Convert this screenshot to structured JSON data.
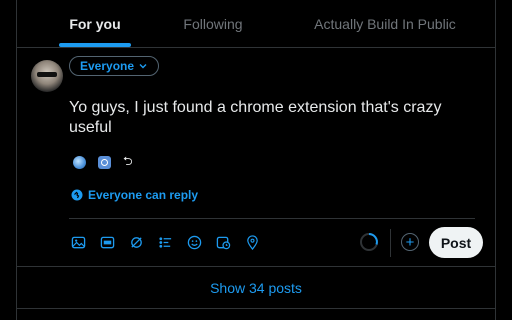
{
  "tabs": [
    {
      "label": "For you",
      "active": true
    },
    {
      "label": "Following",
      "active": false
    },
    {
      "label": "Actually Build In Public",
      "active": false
    }
  ],
  "composer": {
    "audience_label": "Everyone",
    "text": "Yo guys, I just found a chrome extension that's crazy useful",
    "reply_setting": "Everyone can reply",
    "toolbar_icons": [
      "image-icon",
      "gif-icon",
      "grok-icon",
      "poll-icon",
      "emoji-icon",
      "schedule-icon",
      "location-icon"
    ],
    "post_label": "Post"
  },
  "timeline": {
    "show_posts_label": "Show 34 posts"
  },
  "colors": {
    "accent": "#1d9bf0",
    "background": "#000000",
    "text": "#e7e9ea",
    "muted": "#71767b",
    "border": "#2f3336"
  }
}
